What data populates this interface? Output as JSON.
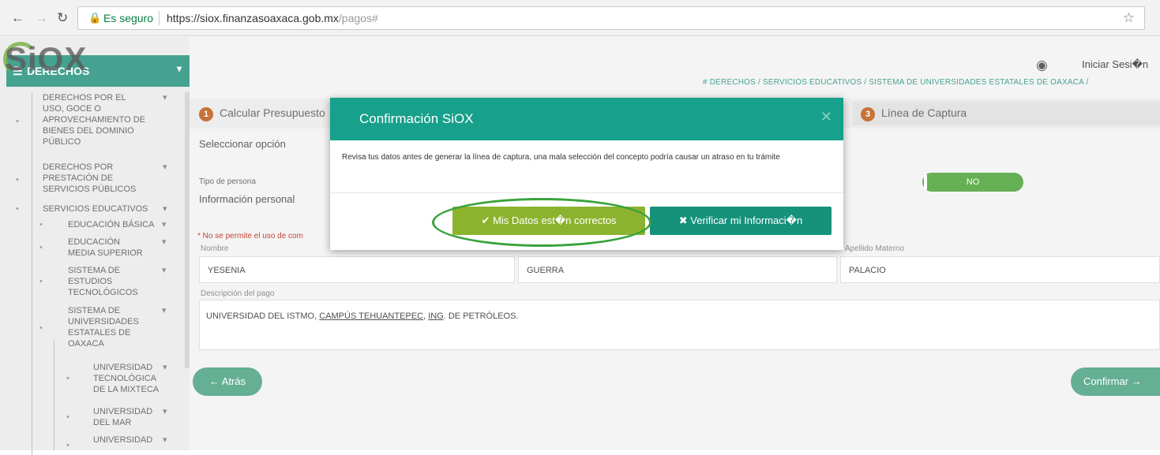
{
  "browser": {
    "back_icon": "arrow-left-icon",
    "forward_icon": "arrow-right-icon",
    "reload_icon": "reload-icon",
    "lock_icon": "lock-icon",
    "secure_label": "Es seguro",
    "url_scheme": "https://",
    "url_host": "siox.finanzasoaxaca.gob.mx",
    "url_path": "/pagos#",
    "star_icon": "star-icon"
  },
  "app": {
    "logo": "SiOX",
    "user_icon": "user-circle-icon",
    "login_label": "Iniciar Sesi�n",
    "breadcrumb": [
      "DERECHOS",
      "SERVICIOS EDUCATIVOS",
      "SISTEMA DE UNIVERSIDADES ESTATALES DE OAXACA"
    ],
    "breadcrumb_sep": " / ",
    "breadcrumb_home_icon": "home-icon"
  },
  "sidebar": {
    "title": "DERECHOS",
    "items": [
      {
        "label": "DERECHOS POR EL USO, GOCE O APROVECHAMIENTO DE BIENES DEL DOMINIO PÚBLICO"
      },
      {
        "label": "DERECHOS POR PRESTACIÓN DE SERVICIOS PÚBLICOS"
      },
      {
        "label": "SERVICIOS EDUCATIVOS"
      },
      {
        "label": "EDUCACIÓN BÁSICA"
      },
      {
        "label": "EDUCACIÓN MEDIA SUPERIOR"
      },
      {
        "label": "SISTEMA DE ESTUDIOS TECNOLÓGICOS"
      },
      {
        "label": "SISTEMA DE UNIVERSIDADES ESTATALES DE OAXACA"
      },
      {
        "label": "UNIVERSIDAD TECNOLÓGICA DE LA MIXTECA"
      },
      {
        "label": "UNIVERSIDAD DEL MAR"
      },
      {
        "label": "UNIVERSIDAD"
      }
    ]
  },
  "steps": [
    {
      "num": "1",
      "label": "Calcular Presupuesto"
    },
    {
      "num": "3",
      "label": "Línea de Captura"
    }
  ],
  "form": {
    "select_option": "Seleccionar opción",
    "tipo_persona_label": "Tipo de persona",
    "info_personal": "Información personal",
    "toggle_value": "NO",
    "warning": "* No se permite el uso de com",
    "nombre_label": "Nombre",
    "apellido_materno_label": "Apellido Materno",
    "nombre": "YESENIA",
    "apellido_paterno": "GUERRA",
    "apellido_materno": "PALACIO",
    "descripcion_label": "Descripción del pago",
    "descripcion": {
      "part1": "UNIVERSIDAD DEL ISTMO, ",
      "part2": "CAMPÚS TEHUANTEPEC",
      "part3": ", ",
      "part4": "ING",
      "part5": ". DE PETRÓLEOS."
    },
    "back_button": "← Atrás",
    "confirm_button": "Confirmar →"
  },
  "modal": {
    "title": "Confirmación SiOX",
    "body": "Revisa tus datos antes de generar la línea de captura, una mala selección del concepto podría causar un atraso en tu trámite",
    "ok_button": "Mis Datos est�n correctos",
    "ok_icon": "check-icon",
    "verify_button": "Verificar mi Informaci�n",
    "verify_icon": "times-icon",
    "close_icon": "close-icon"
  },
  "colors": {
    "teal": "#17a08b",
    "ok_green": "#8cb32e",
    "verify_teal": "#15917c",
    "annotation_ring": "#3aa23c"
  }
}
